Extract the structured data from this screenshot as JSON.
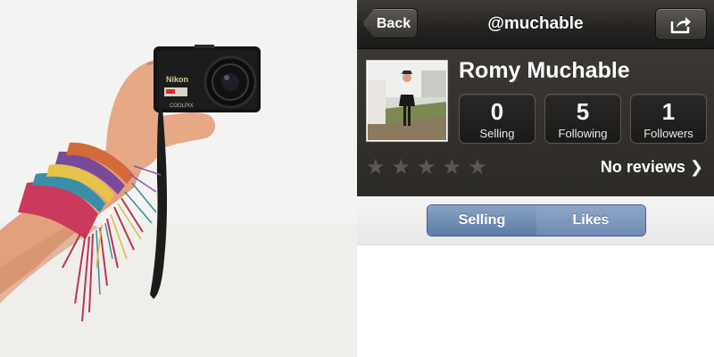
{
  "nav": {
    "back_label": "Back",
    "title": "@muchable",
    "share_icon": "share-icon"
  },
  "profile": {
    "name": "Romy Muchable",
    "stats": {
      "selling": {
        "value": "0",
        "label": "Selling"
      },
      "following": {
        "value": "5",
        "label": "Following"
      },
      "followers": {
        "value": "1",
        "label": "Followers"
      }
    },
    "rating_stars": 0,
    "rating_max": 5,
    "reviews_label": "No reviews"
  },
  "tabs": {
    "selling_label": "Selling",
    "likes_label": "Likes",
    "active": "Selling"
  },
  "photo": {
    "camera_brand": "Nikon",
    "camera_model": "COOLPIX"
  },
  "colors": {
    "nav_dark": "#262422",
    "segment_blue": "#5b7ba6",
    "star_empty": "#5a5855"
  }
}
